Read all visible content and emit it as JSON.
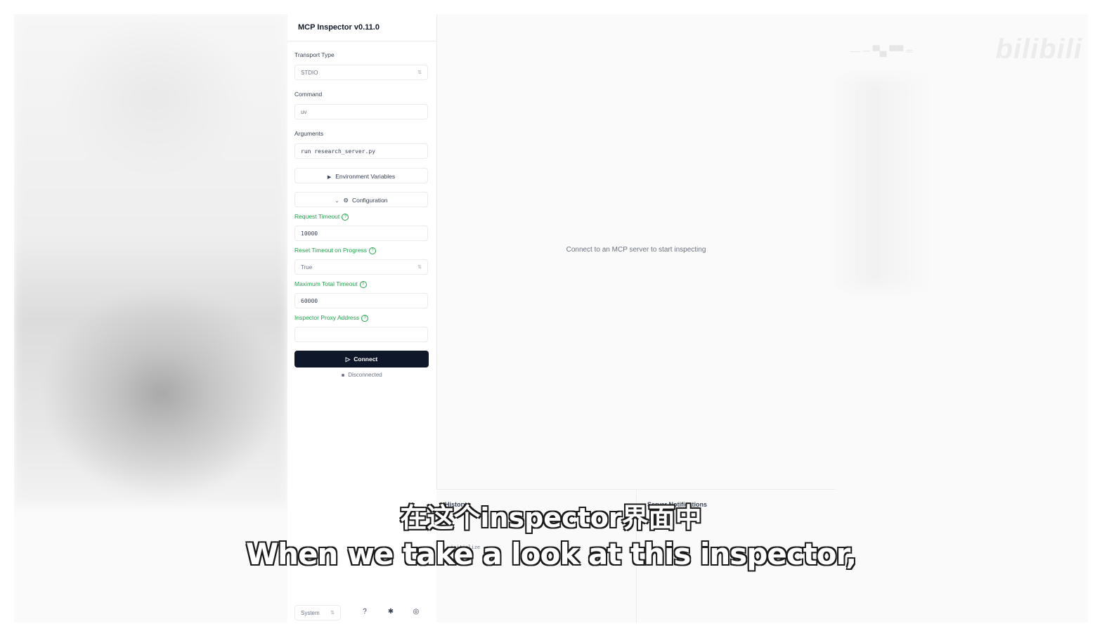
{
  "app": {
    "title": "MCP Inspector v0.11.0"
  },
  "sidebar": {
    "transport_type": {
      "label": "Transport Type",
      "value": "STDIO"
    },
    "command": {
      "label": "Command",
      "value": "uv"
    },
    "arguments": {
      "label": "Arguments",
      "value": "run research_server.py"
    },
    "env_vars_label": "Environment Variables",
    "configuration_label": "Configuration",
    "config": {
      "request_timeout": {
        "label": "Request Timeout",
        "value": "10000"
      },
      "reset_timeout": {
        "label": "Reset Timeout on Progress",
        "value": "True"
      },
      "max_timeout": {
        "label": "Maximum Total Timeout",
        "value": "60000"
      },
      "proxy_address": {
        "label": "Inspector Proxy Address",
        "value": ""
      }
    },
    "connect_label": "Connect",
    "status": "Disconnected",
    "footer": {
      "theme": "System"
    }
  },
  "main": {
    "empty_message": "Connect to an MCP server to start inspecting",
    "history": {
      "title": "History",
      "item": "initialize"
    },
    "notifications": {
      "title": "Server Notifications"
    }
  },
  "watermark": {
    "logo": "bilibili"
  },
  "subtitles": {
    "chinese": "在这个inspector界面中",
    "english": "When we take a look at this inspector,"
  },
  "colors": {
    "accent_green": "#22a04b",
    "connect_button": "#0f172a"
  },
  "icons": [
    "chevron-right-icon",
    "chevron-down-icon",
    "gear-icon",
    "help-circle-icon",
    "play-icon",
    "question-icon",
    "bug-icon",
    "github-icon"
  ]
}
